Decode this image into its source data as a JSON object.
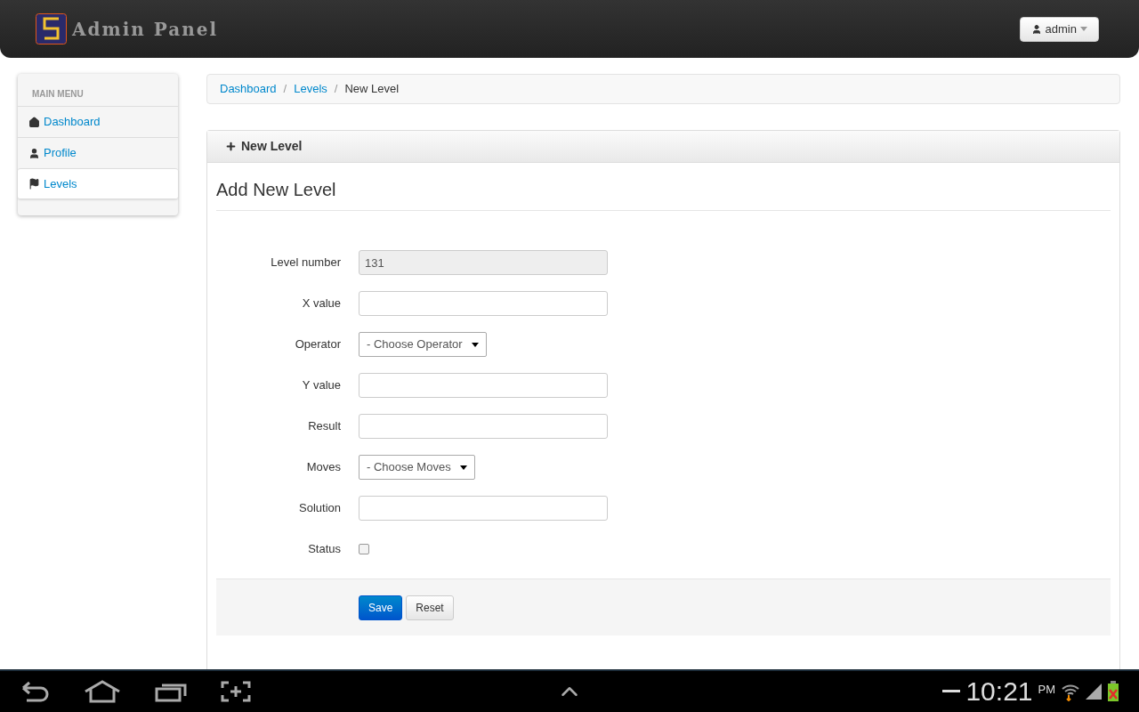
{
  "header": {
    "brand": "Admin Panel",
    "user_menu": "admin"
  },
  "sidebar": {
    "heading": "MAIN MENU",
    "items": [
      {
        "label": "Dashboard",
        "selected": false
      },
      {
        "label": "Profile",
        "selected": false
      },
      {
        "label": "Levels",
        "selected": true
      }
    ]
  },
  "breadcrumb": {
    "separator": "/",
    "items": [
      {
        "label": "Dashboard",
        "link": true
      },
      {
        "label": "Levels",
        "link": true
      },
      {
        "label": "New Level",
        "link": false
      }
    ]
  },
  "panel": {
    "title": "New Level",
    "heading": "Add New Level",
    "fields": [
      {
        "kind": "text",
        "label": "Level number",
        "value": "131",
        "disabled": true
      },
      {
        "kind": "text",
        "label": "X value",
        "disabled": false
      },
      {
        "kind": "select",
        "label": "Operator",
        "value": "- Choose Operator"
      },
      {
        "kind": "text",
        "label": "Y value",
        "disabled": false
      },
      {
        "kind": "text",
        "label": "Result",
        "disabled": false
      },
      {
        "kind": "select",
        "label": "Moves",
        "value": "- Choose Moves"
      },
      {
        "kind": "text",
        "label": "Solution",
        "disabled": false
      },
      {
        "kind": "checkbox",
        "label": "Status",
        "checked": false
      }
    ],
    "buttons": [
      {
        "label": "Save",
        "primary": true
      },
      {
        "label": "Reset",
        "primary": false
      }
    ]
  },
  "system_bar": {
    "time": "10:21",
    "ampm": "PM"
  }
}
